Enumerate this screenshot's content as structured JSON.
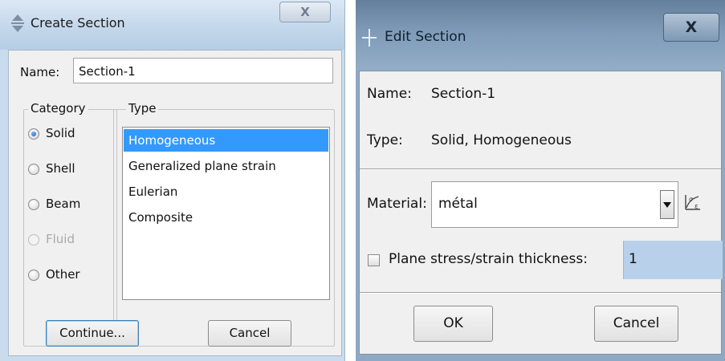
{
  "create_dialog": {
    "title": "Create Section",
    "close_label": "X",
    "name_label": "Name:",
    "name_value": "Section-1",
    "category_label": "Category",
    "type_label": "Type",
    "categories": [
      {
        "label": "Solid",
        "checked": true,
        "disabled": false
      },
      {
        "label": "Shell",
        "checked": false,
        "disabled": false
      },
      {
        "label": "Beam",
        "checked": false,
        "disabled": false
      },
      {
        "label": "Fluid",
        "checked": false,
        "disabled": true
      },
      {
        "label": "Other",
        "checked": false,
        "disabled": false
      }
    ],
    "types": [
      {
        "label": "Homogeneous",
        "selected": true
      },
      {
        "label": "Generalized plane strain",
        "selected": false
      },
      {
        "label": "Eulerian",
        "selected": false
      },
      {
        "label": "Composite",
        "selected": false
      }
    ],
    "continue_label": "Continue...",
    "cancel_label": "Cancel"
  },
  "edit_dialog": {
    "title": "Edit Section",
    "close_label": "X",
    "name_label": "Name:",
    "name_value": "Section-1",
    "type_label": "Type:",
    "type_value": "Solid, Homogeneous",
    "material_label": "Material:",
    "material_value": "métal",
    "material_editor_icon": "material-edit-icon",
    "thickness_label": "Plane stress/strain thickness:",
    "thickness_checked": false,
    "thickness_value": "1",
    "ok_label": "OK",
    "cancel_label": "Cancel"
  },
  "colors": {
    "selection": "#3399ff",
    "titlebar_create": "#c7d9ec",
    "titlebar_edit": "#7e9cbb",
    "thickness_field": "#b8d0ea"
  }
}
